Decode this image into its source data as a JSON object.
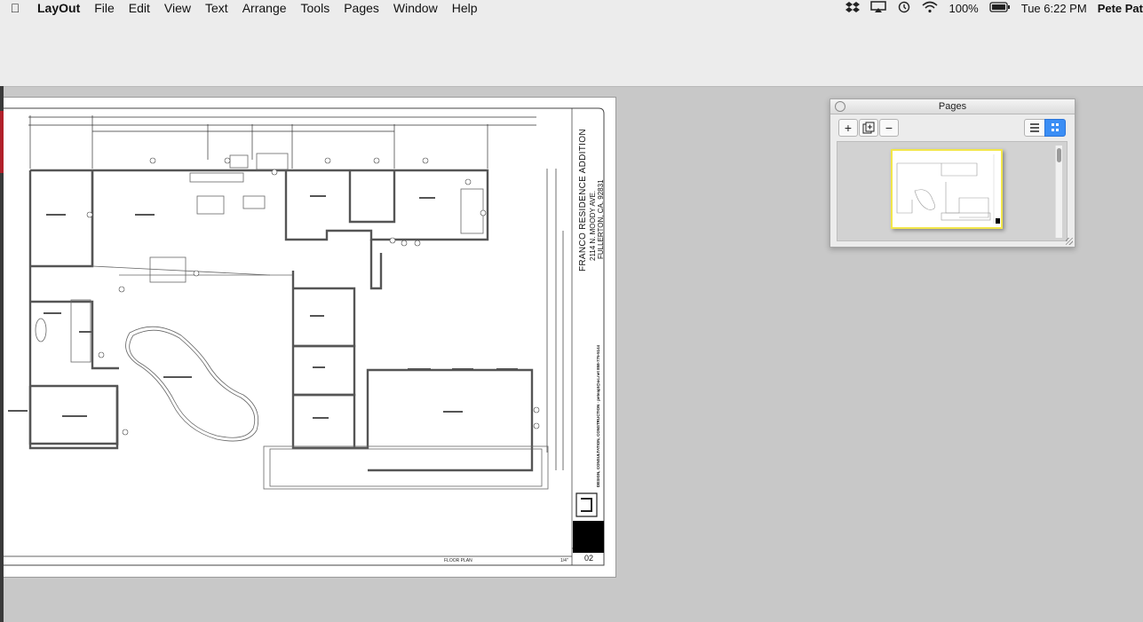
{
  "menubar": {
    "app_name": "LayOut",
    "items": [
      "File",
      "Edit",
      "View",
      "Text",
      "Arrange",
      "Tools",
      "Pages",
      "Window",
      "Help"
    ],
    "battery": "100%",
    "clock": "Tue 6:22 PM",
    "user": "Pete Pat"
  },
  "drawing": {
    "project_title": "FRANCO RESIDENCE ADDITION",
    "address_line1": "2114 N. MOODY AVE.",
    "address_line2": "FULLERTON, CA. 92831",
    "firm_line": "DESIGN, CONSULTATION, CONSTRUCTION · peteapt@oc.net 858-775-5144",
    "sheet_label": "FLOOR PLAN",
    "scale": "1/4\"",
    "sheet_number": "02"
  },
  "pages_panel": {
    "title": "Pages",
    "add_label": "+",
    "remove_label": "−"
  }
}
